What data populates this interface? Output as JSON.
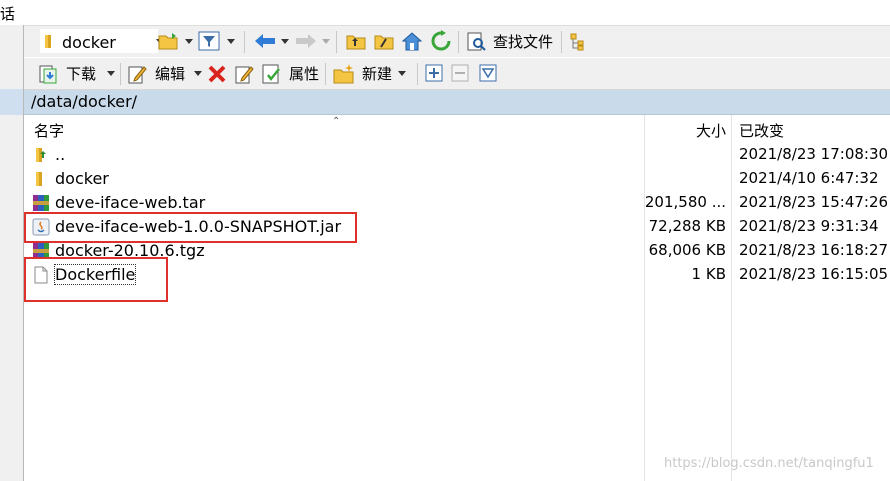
{
  "menubar": {
    "partial_label": "话"
  },
  "toolbar1": {
    "directory_combo": "docker",
    "find_files_label": "查找文件"
  },
  "toolbar2": {
    "download_label": "下载",
    "edit_label": "编辑",
    "properties_label": "属性",
    "new_label": "新建"
  },
  "path": "/data/docker/",
  "columns": {
    "name": "名字",
    "size": "大小",
    "modified": "已改变"
  },
  "files": [
    {
      "name": "..",
      "size": "",
      "modified": "2021/8/23 17:08:30",
      "icon": "parent-folder-icon"
    },
    {
      "name": "docker",
      "size": "",
      "modified": "2021/4/10 6:47:32",
      "icon": "folder-icon"
    },
    {
      "name": "deve-iface-web.tar",
      "size": "201,580 ...",
      "modified": "2021/8/23 15:47:26",
      "icon": "archive-icon"
    },
    {
      "name": "deve-iface-web-1.0.0-SNAPSHOT.jar",
      "size": "72,288 KB",
      "modified": "2021/8/23 9:31:34",
      "icon": "java-jar-icon"
    },
    {
      "name": "docker-20.10.6.tgz",
      "size": "68,006 KB",
      "modified": "2021/8/23 16:18:27",
      "icon": "archive-icon"
    },
    {
      "name": "Dockerfile",
      "size": "1 KB",
      "modified": "2021/8/23 16:15:05",
      "icon": "file-icon"
    }
  ],
  "watermark": "https://blog.csdn.net/tanqingfu1",
  "colors": {
    "path_bar": "#c9daea",
    "highlight_box": "#e0302c",
    "toolbar_bg": "#f0f0f0"
  }
}
